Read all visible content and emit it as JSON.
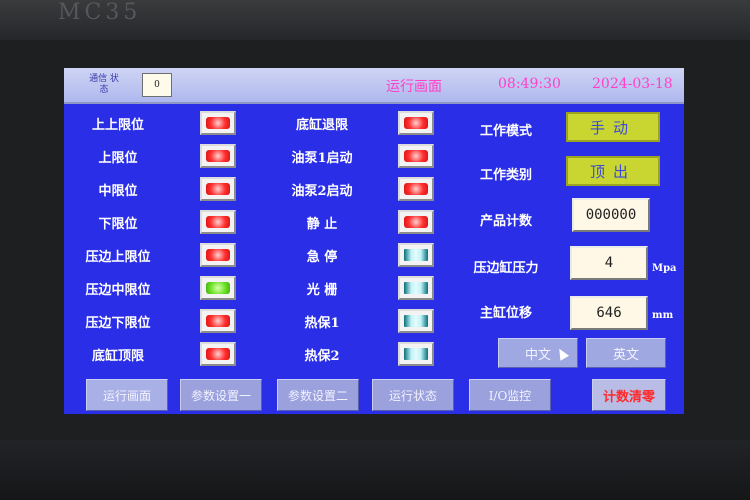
{
  "bezel": {
    "logo": "MC35"
  },
  "header": {
    "comm_label": "通信 状态",
    "comm_value": "0",
    "title": "运行画面",
    "time": "08:49:30",
    "date": "2024-03-18"
  },
  "io_left": [
    {
      "label": "上上限位",
      "state": "red"
    },
    {
      "label": "上限位",
      "state": "red"
    },
    {
      "label": "中限位",
      "state": "red"
    },
    {
      "label": "下限位",
      "state": "red"
    },
    {
      "label": "压边上限位",
      "state": "red"
    },
    {
      "label": "压边中限位",
      "state": "green"
    },
    {
      "label": "压边下限位",
      "state": "red"
    },
    {
      "label": "底缸顶限",
      "state": "red"
    }
  ],
  "io_mid": [
    {
      "label": "底缸退限",
      "state": "red"
    },
    {
      "label": "油泵1启动",
      "state": "red"
    },
    {
      "label": "油泵2启动",
      "state": "red"
    },
    {
      "label": "静 止",
      "state": "red"
    },
    {
      "label": "急 停",
      "state": "cyan"
    },
    {
      "label": "光 栅",
      "state": "cyan"
    },
    {
      "label": "热保1",
      "state": "cyan"
    },
    {
      "label": "热保2",
      "state": "cyan"
    }
  ],
  "status": {
    "work_mode_label": "工作模式",
    "work_mode_value": "手动",
    "work_type_label": "工作类别",
    "work_type_value": "顶出",
    "product_count_label": "产品计数",
    "product_count_value": "000000",
    "edge_pressure_label": "压边缸压力",
    "edge_pressure_value": "4",
    "edge_pressure_unit": "Mpa",
    "main_disp_label": "主缸位移",
    "main_disp_value": "646",
    "main_disp_unit": "mm"
  },
  "language": {
    "chinese": "中文",
    "english": "英文"
  },
  "nav": {
    "run_screen": "运行画面",
    "param1": "参数设置一",
    "param2": "参数设置二",
    "run_status": "运行状态",
    "io_monitor": "I/O监控",
    "count_clear": "计数清零"
  },
  "colors": {
    "screen_bg": "#2a2ee6",
    "header_text": "#ff40c8",
    "lamp_red": "#ff3030",
    "lamp_green": "#6de324",
    "mode_box": "#c9d631",
    "danger_text": "#ff2a2a"
  }
}
